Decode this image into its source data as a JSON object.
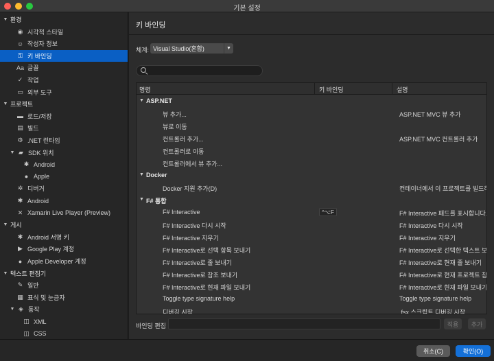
{
  "window": {
    "title": "기본 설정"
  },
  "sidebar": {
    "items": [
      {
        "label": "환경",
        "type": "category",
        "icon": "triangle-down"
      },
      {
        "label": "시각적 스타일",
        "type": "item",
        "icon": "eye-icon",
        "glyph": "◉"
      },
      {
        "label": "작성자 정보",
        "type": "item",
        "icon": "smiley-icon",
        "glyph": "☺"
      },
      {
        "label": "키 바인딩",
        "type": "item",
        "icon": "key-icon",
        "glyph": "⚿",
        "selected": true
      },
      {
        "label": "글꼴",
        "type": "item",
        "icon": "font-icon",
        "glyph": "Aa"
      },
      {
        "label": "작업",
        "type": "item",
        "icon": "checkmark-icon",
        "glyph": "✓"
      },
      {
        "label": "외부 도구",
        "type": "item",
        "icon": "terminal-icon",
        "glyph": "▭"
      },
      {
        "label": "프로젝트",
        "type": "category",
        "icon": "triangle-down"
      },
      {
        "label": "로드/저장",
        "type": "item",
        "icon": "drive-icon",
        "glyph": "▬"
      },
      {
        "label": "빌드",
        "type": "item",
        "icon": "build-icon",
        "glyph": "▤"
      },
      {
        "label": ".NET 런타임",
        "type": "item",
        "icon": "runtime-icon",
        "glyph": "⚙"
      },
      {
        "label": "SDK 위치",
        "type": "item",
        "icon": "folder-icon",
        "glyph": "▰",
        "expandable": true
      },
      {
        "label": "Android",
        "type": "subitem",
        "icon": "android-icon",
        "glyph": "✱"
      },
      {
        "label": "Apple",
        "type": "subitem",
        "icon": "apple-icon",
        "glyph": "●"
      },
      {
        "label": "디버거",
        "type": "item",
        "icon": "bug-icon",
        "glyph": "✲"
      },
      {
        "label": "Android",
        "type": "item",
        "icon": "android-icon",
        "glyph": "✱"
      },
      {
        "label": "Xamarin Live Player (Preview)",
        "type": "item",
        "icon": "xamarin-icon",
        "glyph": "✕"
      },
      {
        "label": "게시",
        "type": "category",
        "icon": "triangle-down"
      },
      {
        "label": "Android 서명 키",
        "type": "item",
        "icon": "android-icon",
        "glyph": "✱"
      },
      {
        "label": "Google Play 계정",
        "type": "item",
        "icon": "google-play-icon",
        "glyph": "▶"
      },
      {
        "label": "Apple Developer 계정",
        "type": "item",
        "icon": "apple-icon",
        "glyph": "●"
      },
      {
        "label": "텍스트 편집기",
        "type": "category",
        "icon": "triangle-down"
      },
      {
        "label": "일반",
        "type": "item",
        "icon": "edit-icon",
        "glyph": "✎"
      },
      {
        "label": "표식 및 눈금자",
        "type": "item",
        "icon": "markers-icon",
        "glyph": "▦"
      },
      {
        "label": "동작",
        "type": "item",
        "icon": "behavior-icon",
        "glyph": "◈",
        "expandable": true
      },
      {
        "label": "XML",
        "type": "subitem",
        "icon": "xml-icon",
        "glyph": "◫"
      },
      {
        "label": "CSS",
        "type": "subitem",
        "icon": "css-icon",
        "glyph": "◫"
      }
    ]
  },
  "content": {
    "title": "키 바인딩",
    "scheme_label": "체계:",
    "scheme_value": "Visual Studio(혼합)",
    "search_placeholder": "",
    "columns": [
      "명령",
      "키 바인딩",
      "설명"
    ],
    "rows": [
      {
        "type": "group",
        "name": "ASP.NET"
      },
      {
        "type": "cmd",
        "name": "뷰 추가...",
        "key": "",
        "desc": "ASP.NET MVC 뷰 추가"
      },
      {
        "type": "cmd",
        "name": "뷰로 이동",
        "key": "",
        "desc": ""
      },
      {
        "type": "cmd",
        "name": "컨트롤러 추가...",
        "key": "",
        "desc": "ASP.NET MVC 컨트롤러 추가"
      },
      {
        "type": "cmd",
        "name": "컨트롤러로 이동",
        "key": "",
        "desc": ""
      },
      {
        "type": "cmd",
        "name": "컨트롤러에서 뷰 추가...",
        "key": "",
        "desc": ""
      },
      {
        "type": "group",
        "name": "Docker"
      },
      {
        "type": "cmd",
        "name": "Docker 지원 추가(D)",
        "key": "",
        "desc": "컨테이너에서 이 프로젝트를 빌드하고"
      },
      {
        "type": "group",
        "name": "F# 통합"
      },
      {
        "type": "cmd",
        "name": "F# Interactive",
        "key": "^⌥F",
        "desc": "F# Interactive 패드를 표시합니다."
      },
      {
        "type": "cmd",
        "name": "F# Interactive 다시 시작",
        "key": "",
        "desc": "F# Interactive 다시 시작"
      },
      {
        "type": "cmd",
        "name": "F# Interactive 지우기",
        "key": "",
        "desc": "F# Interactive 지우기"
      },
      {
        "type": "cmd",
        "name": "F# Interactive로 선택 항목 보내기",
        "key": "",
        "desc": "F# Interactive로 선택한 텍스트 보내"
      },
      {
        "type": "cmd",
        "name": "F# Interactive로 줄 보내기",
        "key": "",
        "desc": "F# Interactive로 현재 줄 보내기"
      },
      {
        "type": "cmd",
        "name": "F# Interactive로 참조 보내기",
        "key": "",
        "desc": "F# Interactive로 현재 프로젝트 참"
      },
      {
        "type": "cmd",
        "name": "F# Interactive로 현재 파일 보내기",
        "key": "",
        "desc": "F# Interactive로 현재 파일 보내기"
      },
      {
        "type": "cmd",
        "name": "Toggle type signature help",
        "key": "",
        "desc": "Toggle type signature help"
      },
      {
        "type": "cmd",
        "name": "디버깅 시작",
        "key": "",
        "desc": ".fsx 스크립트 디버깅 시작"
      }
    ],
    "binding_label": "바인딩 편집",
    "apply_label": "적용",
    "add_label": "추가"
  },
  "footer": {
    "cancel_label": "취소(C)",
    "ok_label": "확인(O)"
  }
}
